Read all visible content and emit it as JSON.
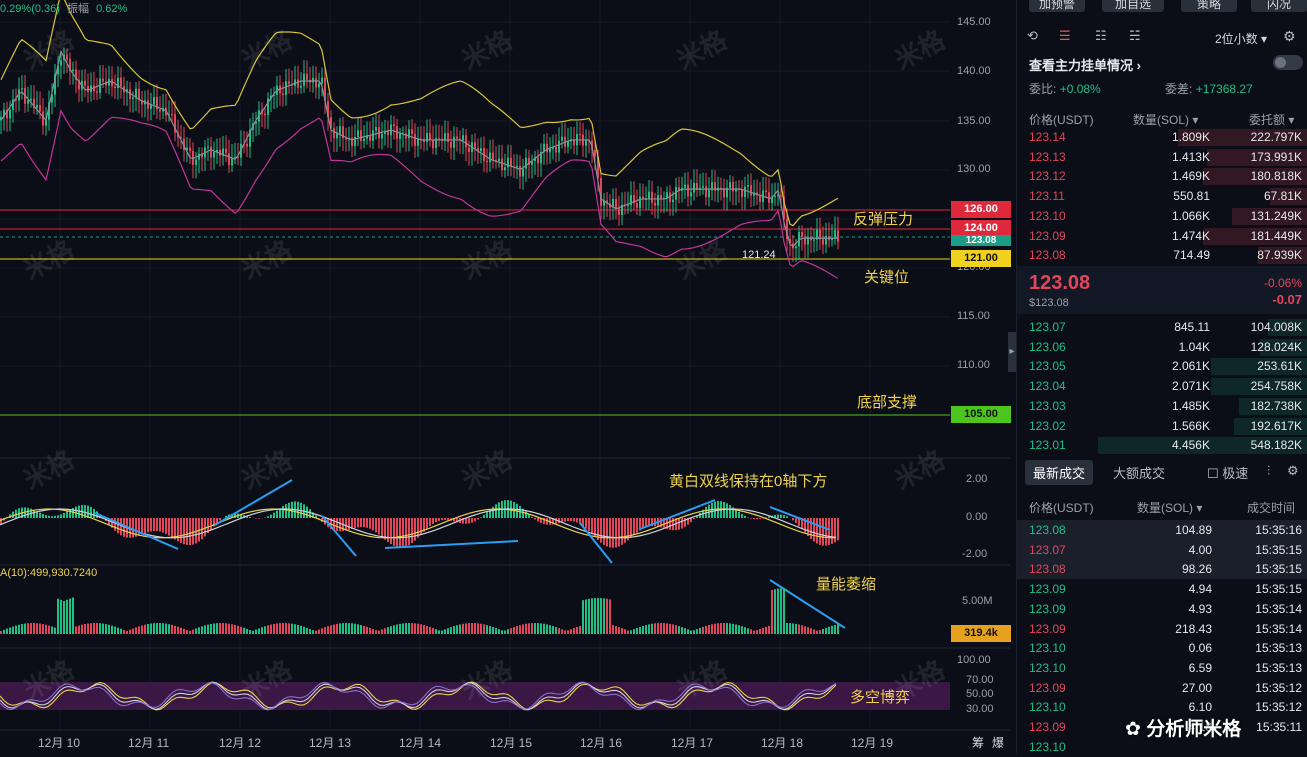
{
  "top_info": {
    "change": "0.29%(0.36)",
    "amp_label": "振幅",
    "amp_value": "0.62%"
  },
  "price_axis": [
    "145.00",
    "140.00",
    "135.00",
    "130.00",
    "120.00",
    "115.00",
    "110.00"
  ],
  "indicator_axis": [
    "2.00",
    "0.00",
    "-2.00"
  ],
  "volume_axis": [
    "5.00M"
  ],
  "rsi_axis": [
    "100.00",
    "70.00",
    "50.00",
    "30.00"
  ],
  "price_tags": {
    "resist1": "126.00",
    "resist2": "124.00",
    "current": "123.08",
    "key": "121.00",
    "support": "105.00",
    "volume": "319.4k"
  },
  "low_marker": "121.24",
  "volume_label": "A(10):499,930.7240",
  "annotations": {
    "resistance": "反弹压力",
    "key_level": "关键位",
    "bottom_support": "底部支撑",
    "macd_note": "黄白双线保持在0轴下方",
    "volume_note": "量能萎缩",
    "rsi_note": "多空博弈"
  },
  "x_axis": [
    "12月 10",
    "12月 11",
    "12月 12",
    "12月 13",
    "12月 14",
    "12月 15",
    "12月 16",
    "12月 17",
    "12月 18",
    "12月 19"
  ],
  "x_axis_right": [
    "筹",
    "爆"
  ],
  "watermark": "米格",
  "credit": "分析师米格",
  "side_panel": {
    "top_buttons": [
      "加预警",
      "加自选",
      "策略",
      "闪况"
    ],
    "decimal_select": "2位小数",
    "main_force_title": "查看主力挂单情况",
    "ratio_label": "委比:",
    "ratio_value": "+0.08%",
    "diff_label": "委差:",
    "diff_value": "+17368.27",
    "book_headers": {
      "price": "价格(USDT)",
      "qty": "数量(SOL)",
      "total": "委托额"
    },
    "asks": [
      {
        "price": "123.14",
        "qty": "1.809K",
        "total": "222.797K",
        "depth": 0.62
      },
      {
        "price": "123.13",
        "qty": "1.413K",
        "total": "173.991K",
        "depth": 0.48
      },
      {
        "price": "123.12",
        "qty": "1.469K",
        "total": "180.818K",
        "depth": 0.5
      },
      {
        "price": "123.11",
        "qty": "550.81",
        "total": "67.81K",
        "depth": 0.18
      },
      {
        "price": "123.10",
        "qty": "1.066K",
        "total": "131.249K",
        "depth": 0.36
      },
      {
        "price": "123.09",
        "qty": "1.474K",
        "total": "181.449K",
        "depth": 0.5
      },
      {
        "price": "123.08",
        "qty": "714.49",
        "total": "87.939K",
        "depth": 0.24
      }
    ],
    "last_price": "123.08",
    "last_price_usd": "$123.08",
    "last_change_pct": "-0.06%",
    "last_change": "-0.07",
    "bids": [
      {
        "price": "123.07",
        "qty": "845.11",
        "total": "104.008K",
        "depth": 0.19
      },
      {
        "price": "123.06",
        "qty": "1.04K",
        "total": "128.024K",
        "depth": 0.23
      },
      {
        "price": "123.05",
        "qty": "2.061K",
        "total": "253.61K",
        "depth": 0.46
      },
      {
        "price": "123.04",
        "qty": "2.071K",
        "total": "254.758K",
        "depth": 0.46
      },
      {
        "price": "123.03",
        "qty": "1.485K",
        "total": "182.738K",
        "depth": 0.33
      },
      {
        "price": "123.02",
        "qty": "1.566K",
        "total": "192.617K",
        "depth": 0.35
      },
      {
        "price": "123.01",
        "qty": "4.456K",
        "total": "548.182K",
        "depth": 1.0
      }
    ],
    "tabs": {
      "latest": "最新成交",
      "large": "大额成交",
      "speed": "极速"
    },
    "trade_headers": {
      "price": "价格(USDT)",
      "qty": "数量(SOL)",
      "time": "成交时间"
    },
    "trades": [
      {
        "price": "123.08",
        "qty": "104.89",
        "time": "15:35:16",
        "side": "buy"
      },
      {
        "price": "123.07",
        "qty": "4.00",
        "time": "15:35:15",
        "side": "sell"
      },
      {
        "price": "123.08",
        "qty": "98.26",
        "time": "15:35:15",
        "side": "sell"
      },
      {
        "price": "123.09",
        "qty": "4.94",
        "time": "15:35:15",
        "side": "buy"
      },
      {
        "price": "123.09",
        "qty": "4.93",
        "time": "15:35:14",
        "side": "buy"
      },
      {
        "price": "123.09",
        "qty": "218.43",
        "time": "15:35:14",
        "side": "sell"
      },
      {
        "price": "123.10",
        "qty": "0.06",
        "time": "15:35:13",
        "side": "buy"
      },
      {
        "price": "123.10",
        "qty": "6.59",
        "time": "15:35:13",
        "side": "buy"
      },
      {
        "price": "123.09",
        "qty": "27.00",
        "time": "15:35:12",
        "side": "sell"
      },
      {
        "price": "123.10",
        "qty": "6.10",
        "time": "15:35:12",
        "side": "buy"
      },
      {
        "price": "123.09",
        "qty": "4.18",
        "time": "15:35:11",
        "side": "sell"
      },
      {
        "price": "123.10",
        "qty": "",
        "time": "",
        "side": "buy"
      }
    ]
  }
}
